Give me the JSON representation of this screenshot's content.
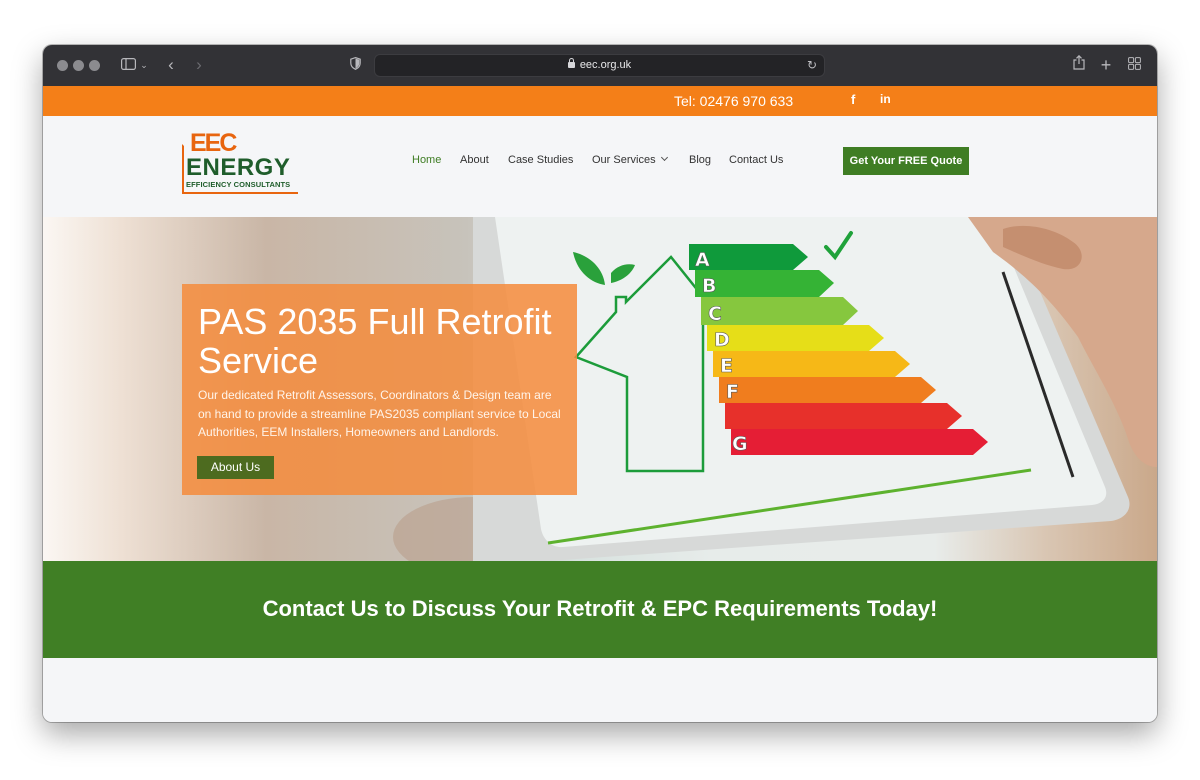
{
  "browser": {
    "url": "eec.org.uk",
    "icons": [
      "sidebar-icon",
      "back-icon",
      "forward-icon",
      "shield-icon",
      "lock-icon",
      "reload-icon",
      "share-icon",
      "new-tab-icon",
      "tab-overview-icon"
    ]
  },
  "topbar": {
    "phone": "Tel: 02476 970 633",
    "facebook": "f",
    "linkedin": "in"
  },
  "logo": {
    "eec": "EEC",
    "energy": "ENERGY",
    "subtitle": "EFFICIENCY CONSULTANTS"
  },
  "nav": {
    "items": [
      {
        "label": "Home",
        "active": true
      },
      {
        "label": "About"
      },
      {
        "label": "Case Studies"
      },
      {
        "label": "Our Services",
        "dropdown": true
      },
      {
        "label": "Blog"
      },
      {
        "label": "Contact Us"
      }
    ],
    "cta": "Get Your FREE Quote"
  },
  "hero": {
    "title": "PAS 2035 Full Retrofit Service",
    "text": "Our dedicated Retrofit Assessors, Coordinators & Design team are on hand to provide a streamline PAS2035 compliant service to Local Authorities, EEM Installers, Homeowners and Landlords.",
    "button": "About Us",
    "ratings": [
      "A",
      "B",
      "C",
      "D",
      "E",
      "F",
      "G"
    ]
  },
  "banner": {
    "text": "Contact Us to Discuss Your Retrofit & EPC Requirements Today!"
  },
  "colors": {
    "orange": "#f47f18",
    "green": "#407f25",
    "logo_green": "#1f5d2b"
  }
}
